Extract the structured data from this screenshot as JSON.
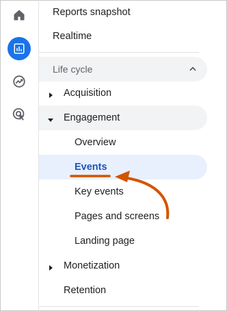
{
  "rail": {
    "icons": [
      {
        "name": "home-icon",
        "active": false
      },
      {
        "name": "reports-icon",
        "active": true
      },
      {
        "name": "explore-icon",
        "active": false
      },
      {
        "name": "advertising-icon",
        "active": false
      }
    ],
    "accent": "#1a73e8"
  },
  "nav": {
    "reports_snapshot": "Reports snapshot",
    "realtime": "Realtime",
    "section_title": "Life cycle",
    "acquisition": "Acquisition",
    "engagement": "Engagement",
    "engagement_items": [
      {
        "label": "Overview"
      },
      {
        "label": "Events"
      },
      {
        "label": "Key events"
      },
      {
        "label": "Pages and screens"
      },
      {
        "label": "Landing page"
      }
    ],
    "selected_item": "Events",
    "monetization": "Monetization",
    "retention": "Retention"
  },
  "annotation": {
    "arrow_color": "#d35400",
    "underline_color": "#d35400"
  }
}
